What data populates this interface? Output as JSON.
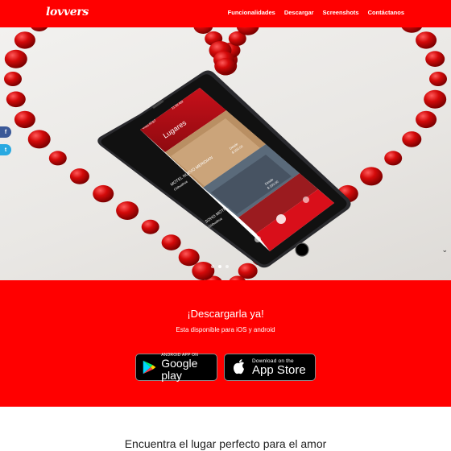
{
  "brand": {
    "logo": "lovvers",
    "accent": "#ff0000"
  },
  "nav": {
    "items": [
      {
        "label": "Funcionalidades"
      },
      {
        "label": "Descargar"
      },
      {
        "label": "Screenshots"
      },
      {
        "label": "Contáctanos"
      }
    ]
  },
  "social": {
    "facebook": "f",
    "twitter": "t"
  },
  "hero": {
    "carousel": {
      "slides": 3,
      "active": 1
    },
    "phone": {
      "status_carrier": "•••oo AT&T",
      "status_time": "11:58 AM",
      "header_title": "Lugares",
      "cards": [
        {
          "name": "MOTEL NUEVO MERIDIAN",
          "city": "Chihuahua",
          "price_label": "Desde",
          "price": "$ 250.00"
        },
        {
          "name": "SOHO MOTEL",
          "city": "Chihuahua",
          "price_label": "Desde",
          "price": "$ 150.00"
        }
      ]
    }
  },
  "cta": {
    "title": "¡Descargarla ya!",
    "subtitle": "Esta disponible para iOS y android",
    "google_play": {
      "small": "ANDROID APP ON",
      "big": "Google play"
    },
    "app_store": {
      "small": "Download on the",
      "big": "App Store"
    }
  },
  "section": {
    "title": "Encuentra el lugar perfecto para el amor"
  }
}
